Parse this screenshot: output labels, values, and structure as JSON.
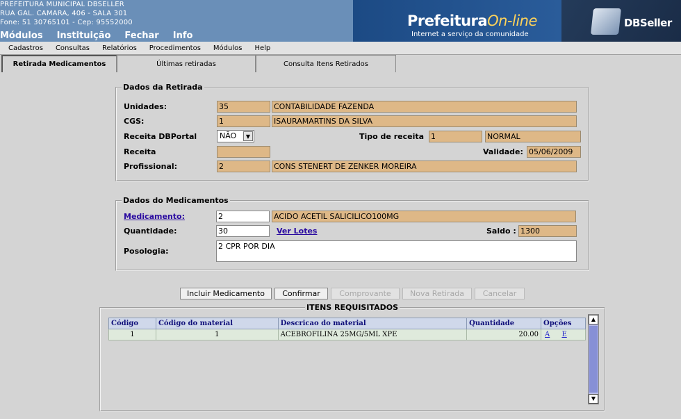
{
  "header": {
    "org_line1": "PREFEITURA MUNICIPAL DBSELLER",
    "org_line2": "RUA GAL. CAMARA, 406 - SALA 301",
    "org_line3": "Fone: 51 30765101  -  Cep: 95552000",
    "menu": [
      "Módulos",
      "Instituição",
      "Fechar",
      "Info"
    ],
    "logo_main": "Prefeitura",
    "logo_accent": "On-line",
    "logo_sub": "Internet a serviço da comunidade",
    "db_logo": "DBSeller"
  },
  "menubar": [
    "Cadastros",
    "Consultas",
    "Relatórios",
    "Procedimentos",
    "Módulos",
    "Help"
  ],
  "tabs": [
    "Retirada Medicamentos",
    "Últimas retiradas",
    "Consulta Itens Retirados"
  ],
  "retirada": {
    "legend": "Dados da Retirada",
    "unidades_label": "Unidades:",
    "unidades_code": "35",
    "unidades_name": "CONTABILIDADE FAZENDA",
    "cgs_label": "CGS:",
    "cgs_code": "1",
    "cgs_name": "ISAURAMARTINS DA SILVA",
    "receita_dbportal_label": "Receita DBPortal",
    "receita_dbportal_value": "NÃO",
    "tipo_receita_label": "Tipo de receita",
    "tipo_receita_code": "1",
    "tipo_receita_name": "NORMAL",
    "receita_label": "Receita",
    "receita_value": "",
    "validade_label": "Validade:",
    "validade_value": "05/06/2009",
    "profissional_label": "Profissional:",
    "profissional_code": "2",
    "profissional_name": "CONS STENERT DE ZENKER MOREIRA"
  },
  "medicamentos": {
    "legend": "Dados do Medicamentos",
    "medicamento_link": "Medicamento:",
    "medicamento_code": "2",
    "medicamento_name": "ACIDO ACETIL SALICILICO100MG",
    "quantidade_label": "Quantidade:",
    "quantidade_value": "30",
    "ver_lotes": "Ver Lotes",
    "saldo_label": "Saldo :",
    "saldo_value": "1300",
    "posologia_label": "Posologia:",
    "posologia_value": "2 CPR POR DIA"
  },
  "buttons": {
    "incluir": "Incluir Medicamento",
    "confirmar": "Confirmar",
    "comprovante": "Comprovante",
    "nova": "Nova Retirada",
    "cancelar": "Cancelar"
  },
  "itens": {
    "legend": "ITENS REQUISITADOS",
    "columns": [
      "Código",
      "Código do material",
      "Descricao do material",
      "Quantidade",
      "Opções"
    ],
    "rows": [
      {
        "codigo": "1",
        "codigo_material": "1",
        "descricao": "ACEBROFILINA 25MG/5ML XPE",
        "quantidade": "20.00",
        "opt_a": "A",
        "opt_e": "E"
      }
    ]
  }
}
